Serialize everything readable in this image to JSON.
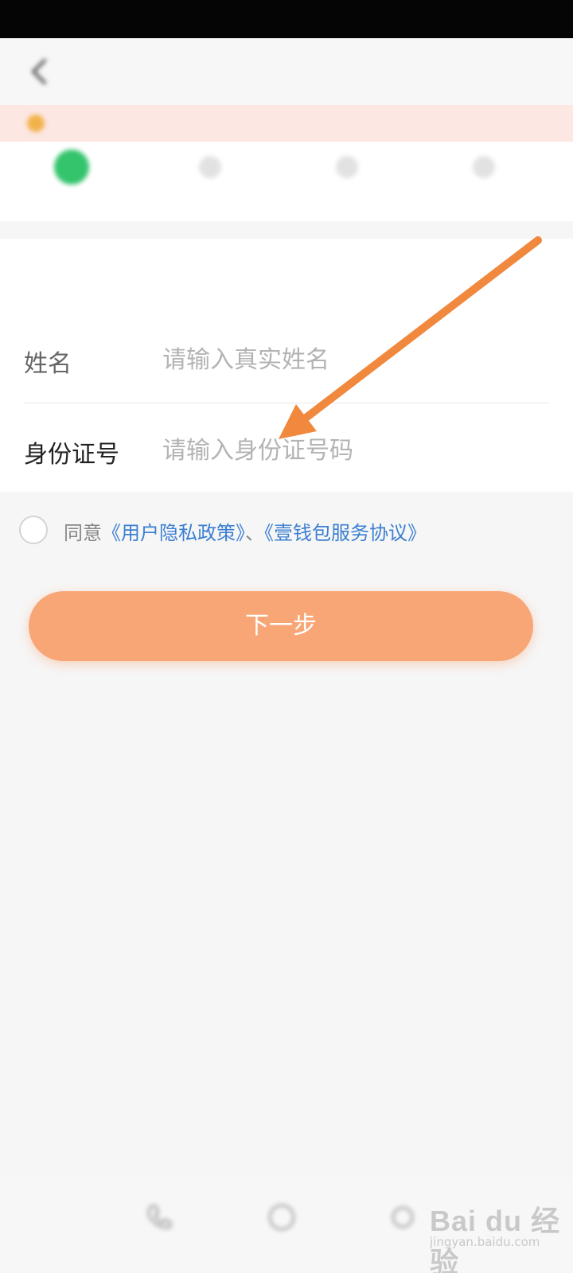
{
  "status_bar": {
    "time": "",
    "right": ""
  },
  "nav": {
    "title": "",
    "back_icon": "chevron-left-icon"
  },
  "notice": {
    "icon": "bell-icon",
    "text": ""
  },
  "steps": [
    {
      "label": "",
      "state": "active"
    },
    {
      "label": "",
      "state": "inactive"
    },
    {
      "label": "",
      "state": "inactive"
    },
    {
      "label": "",
      "state": "inactive"
    }
  ],
  "form": {
    "section_title": "",
    "name": {
      "label": "姓名",
      "placeholder": "请输入真实姓名",
      "value": "",
      "action": ""
    },
    "id_number": {
      "label": "身份证号",
      "placeholder": "请输入身份证号码",
      "value": ""
    }
  },
  "agreement": {
    "checked": false,
    "prefix": "同意",
    "privacy_link": "《用户隐私政策》",
    "separator": "、",
    "service_link": "《壹钱包服务协议》"
  },
  "next_button": {
    "label": "下一步"
  },
  "footer": {
    "text": ""
  },
  "bottom_bar": {
    "icons": [
      "phone-icon",
      "chat-icon",
      "settings-icon"
    ]
  },
  "watermark": {
    "brand": "Bai du 经验",
    "url": "jingyan.baidu.com"
  },
  "colors": {
    "accent": "#f9a677",
    "link": "#3b7fd1",
    "step_active": "#34c46c",
    "notice_bg": "#fde7e3",
    "notice_text": "#e8533f",
    "annotation_arrow": "#f0883e"
  }
}
